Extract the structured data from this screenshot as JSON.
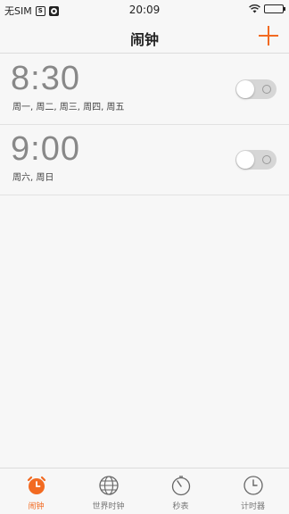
{
  "status_bar": {
    "carrier": "无SIM",
    "time": "20:09"
  },
  "header": {
    "title": "闹钟"
  },
  "alarms": [
    {
      "time": "8:30",
      "days": "周一, 周二, 周三, 周四, 周五",
      "enabled": false
    },
    {
      "time": "9:00",
      "days": "周六, 周日",
      "enabled": false
    }
  ],
  "tabs": [
    {
      "label": "闹钟",
      "icon": "alarm-clock-icon",
      "active": true
    },
    {
      "label": "世界时钟",
      "icon": "globe-icon",
      "active": false
    },
    {
      "label": "秒表",
      "icon": "stopwatch-icon",
      "active": false
    },
    {
      "label": "计时器",
      "icon": "timer-icon",
      "active": false
    }
  ],
  "colors": {
    "accent": "#f26a21",
    "toggle_off": "#d6d6d6"
  }
}
